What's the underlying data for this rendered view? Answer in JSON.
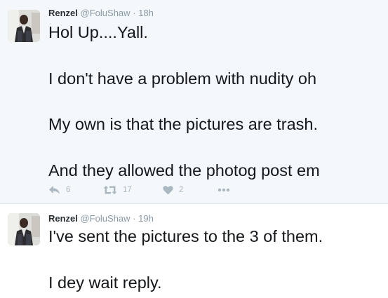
{
  "colors": {
    "selected_bg": "#f5f8fa",
    "text": "#14171a",
    "meta": "#8899a6",
    "action_icons": "#aab8c2"
  },
  "tweets": [
    {
      "name": "Renzel",
      "handle": "@FoluShaw",
      "separator": "·",
      "time": "18h",
      "text": "Hol Up....Yall.\n\nI don't have a problem with nudity oh\n\nMy own is that the pictures are trash.\n\nAnd they allowed the photog post em",
      "actions": {
        "reply_icon": "reply-icon",
        "reply_count": "6",
        "retweet_icon": "retweet-icon",
        "retweet_count": "17",
        "like_icon": "heart-icon",
        "like_count": "2",
        "more_icon": "more-dots-icon"
      }
    },
    {
      "name": "Renzel",
      "handle": "@FoluShaw",
      "separator": "·",
      "time": "19h",
      "text": "I've sent the pictures to the 3 of them.\n\nI dey wait reply."
    }
  ]
}
